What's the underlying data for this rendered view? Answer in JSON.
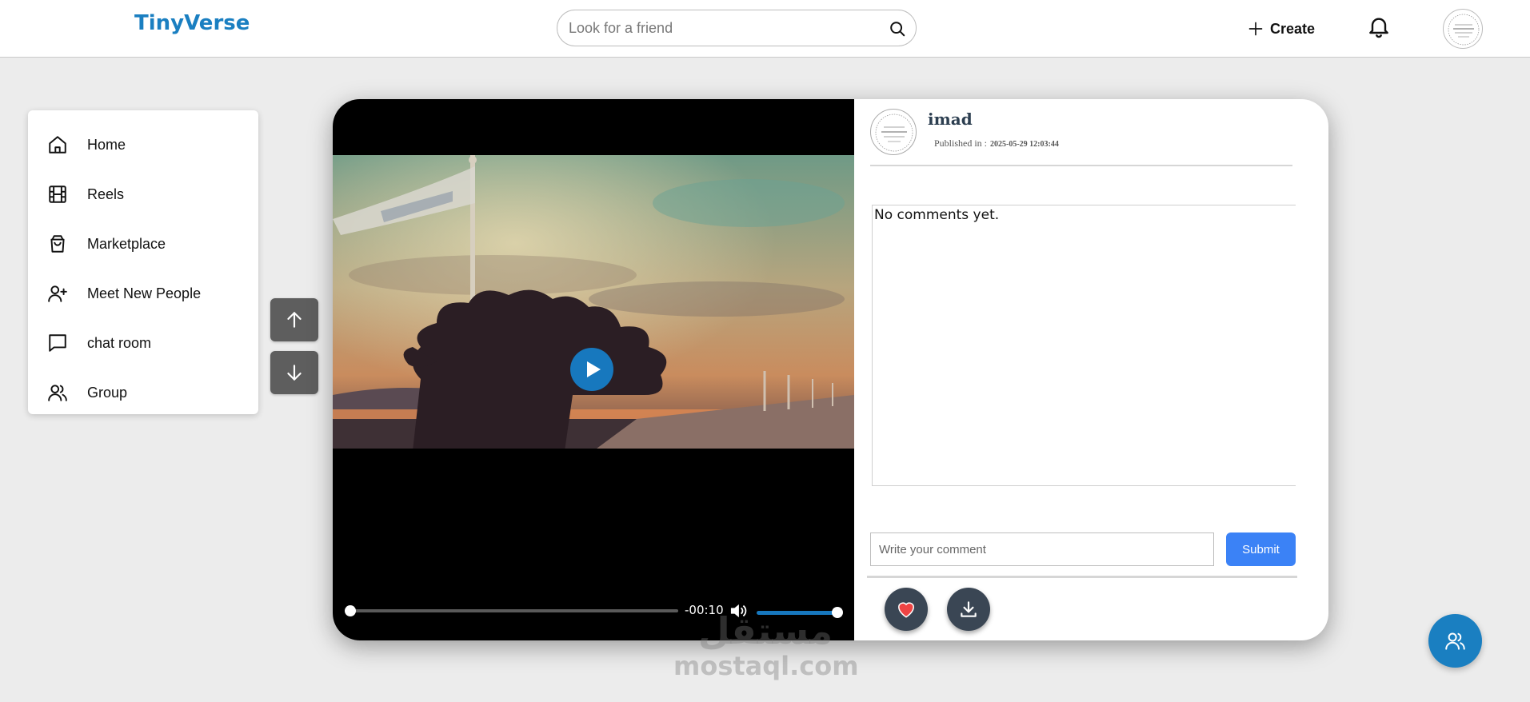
{
  "header": {
    "logo": "TinyVerse",
    "search_placeholder": "Look for a friend",
    "create_label": "Create"
  },
  "sidebar": {
    "items": [
      {
        "label": "Home",
        "icon": "home-icon"
      },
      {
        "label": "Reels",
        "icon": "film-icon"
      },
      {
        "label": "Marketplace",
        "icon": "shopping-bag-icon"
      },
      {
        "label": "Meet New People",
        "icon": "user-plus-icon"
      },
      {
        "label": "chat room",
        "icon": "chat-bubble-icon"
      },
      {
        "label": "Group",
        "icon": "users-icon"
      }
    ]
  },
  "post": {
    "author": "imad",
    "published_label": "Published in :",
    "published_date": "2025-05-29 12:03:44",
    "comments_empty": "No comments yet.",
    "comment_placeholder": "Write your comment",
    "submit_label": "Submit",
    "video": {
      "time_remaining": "-00:10",
      "progress": 0,
      "volume": 1.0
    }
  },
  "watermark": {
    "arabic": "مستقل",
    "latin": "mostaql.com"
  },
  "colors": {
    "brand": "#1a7fc1",
    "submit": "#3b82f6",
    "like_heart": "#ef4444",
    "action_button": "#3a4654"
  }
}
